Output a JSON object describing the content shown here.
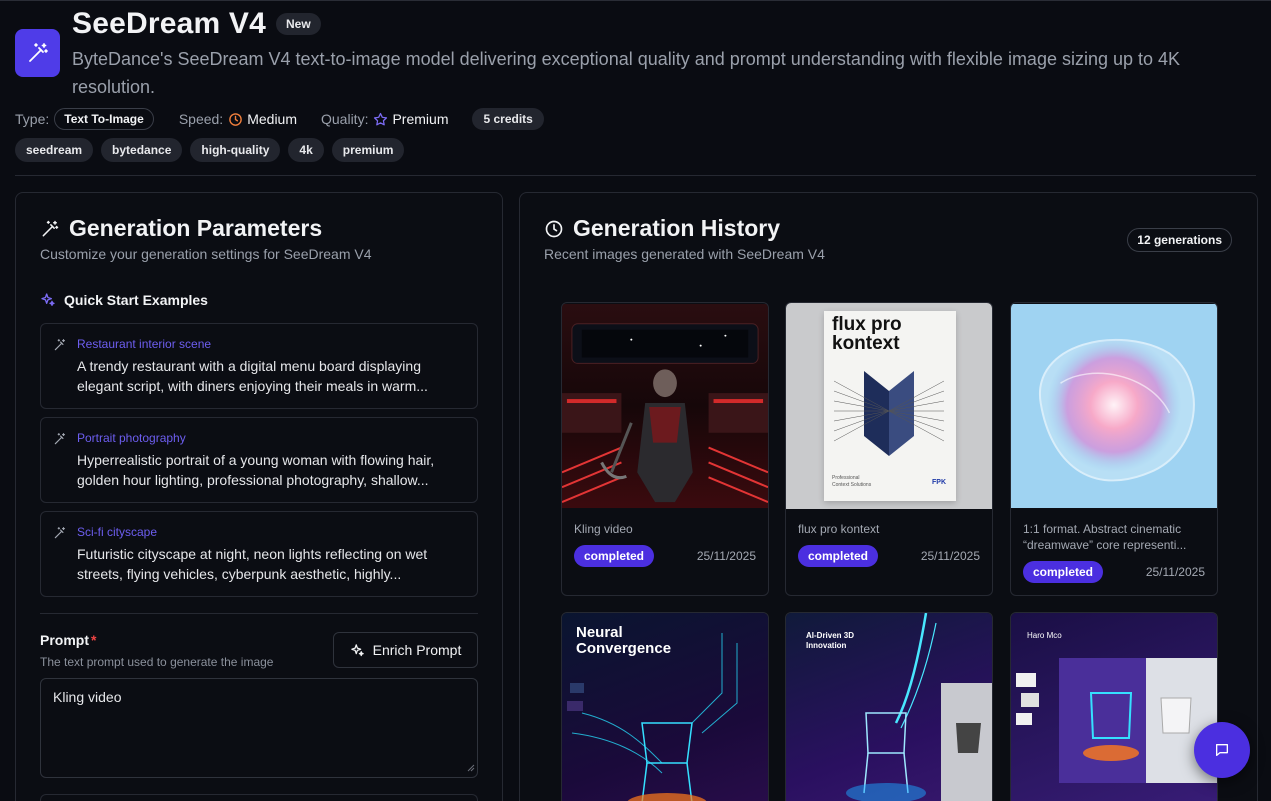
{
  "model": {
    "title": "SeeDream V4",
    "badge": "New",
    "description": "ByteDance's SeeDream V4 text-to-image model delivering exceptional quality and prompt understanding with flexible image sizing up to 4K resolution.",
    "icon": "magic-wand-icon",
    "accent_color": "#4f3ce8"
  },
  "meta": {
    "type_label": "Type:",
    "type_value": "Text To-Image",
    "speed_label": "Speed:",
    "speed_value": "Medium",
    "speed_color": "#f07f3c",
    "quality_label": "Quality:",
    "quality_value": "Premium",
    "quality_color": "#7c6cf5",
    "credits": "5 credits"
  },
  "tags": [
    "seedream",
    "bytedance",
    "high-quality",
    "4k",
    "premium"
  ],
  "parameters": {
    "title": "Generation Parameters",
    "subtitle": "Customize your generation settings for SeeDream V4",
    "quick_start_title": "Quick Start Examples",
    "examples": [
      {
        "label": "Restaurant interior scene",
        "text": "A trendy restaurant with a digital menu board displaying elegant script, with diners enjoying their meals in warm..."
      },
      {
        "label": "Portrait photography",
        "text": "Hyperrealistic portrait of a young woman with flowing hair, golden hour lighting, professional photography, shallow..."
      },
      {
        "label": "Sci-fi cityscape",
        "text": "Futuristic cityscape at night, neon lights reflecting on wet streets, flying vehicles, cyberpunk aesthetic, highly..."
      }
    ],
    "prompt_label": "Prompt",
    "prompt_required": "*",
    "prompt_help": "The text prompt used to generate the image",
    "enrich_button": "Enrich Prompt",
    "prompt_value": "Kling video"
  },
  "history": {
    "title": "Generation History",
    "subtitle": "Recent images generated with SeeDream V4",
    "count": "12 generations",
    "items": [
      {
        "caption": "Kling video",
        "status": "completed",
        "date": "25/11/2025"
      },
      {
        "caption": "flux pro kontext",
        "status": "completed",
        "date": "25/11/2025",
        "thumb_text_1": "flux pro",
        "thumb_text_2": "kontext",
        "thumb_small_1": "Professional",
        "thumb_small_2": "Context Solutions",
        "thumb_brand": "FPK"
      },
      {
        "caption": "1:1 format. Abstract cinematic “dreamwave” core representi...",
        "status": "completed",
        "date": "25/11/2025"
      },
      {
        "caption": "",
        "thumb_text_1": "Neural",
        "thumb_text_2": "Convergence"
      },
      {
        "caption": "",
        "thumb_text_1": "AI-Driven 3D",
        "thumb_text_2": "Innovation"
      },
      {
        "caption": "",
        "thumb_text_1": "Haro Mco"
      }
    ]
  },
  "chat": {
    "icon": "chat-bubble-icon"
  }
}
